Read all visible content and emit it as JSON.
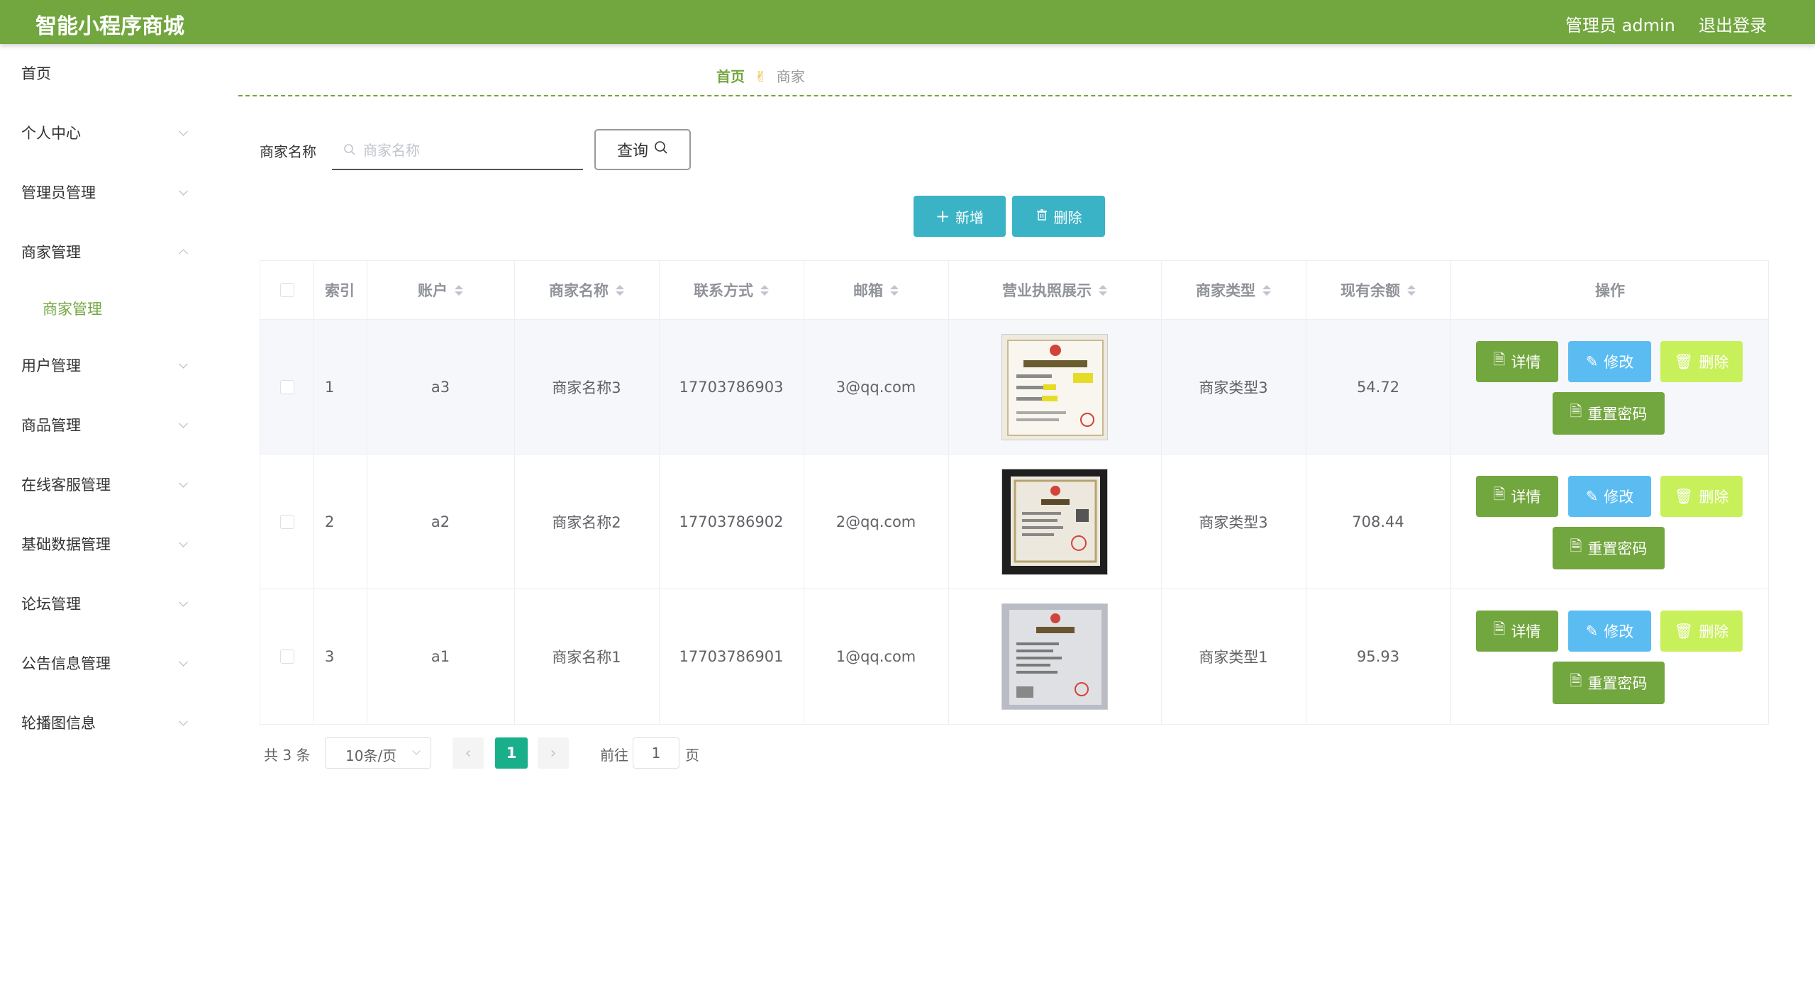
{
  "header": {
    "title": "智能小程序商城",
    "admin": "管理员 admin",
    "logout": "退出登录"
  },
  "sidebar": {
    "items": [
      {
        "label": "首页"
      },
      {
        "label": "个人中心"
      },
      {
        "label": "管理员管理"
      },
      {
        "label": "商家管理"
      },
      {
        "label": "商家管理"
      },
      {
        "label": "用户管理"
      },
      {
        "label": "商品管理"
      },
      {
        "label": "在线客服管理"
      },
      {
        "label": "基础数据管理"
      },
      {
        "label": "论坛管理"
      },
      {
        "label": "公告信息管理"
      },
      {
        "label": "轮播图信息"
      }
    ]
  },
  "breadcrumb": {
    "home": "首页",
    "separator": "✌",
    "current": "商家"
  },
  "search": {
    "label": "商家名称",
    "placeholder": "商家名称",
    "value": "",
    "button": "查询"
  },
  "toolbar": {
    "add": "新增",
    "delete": "删除"
  },
  "table": {
    "columns": [
      "索引",
      "账户",
      "商家名称",
      "联系方式",
      "邮箱",
      "营业执照展示",
      "商家类型",
      "现有余额",
      "操作"
    ],
    "rows": [
      {
        "index": "1",
        "account": "a3",
        "name": "商家名称3",
        "phone": "17703786903",
        "email": "3@qq.com",
        "type": "商家类型3",
        "balance": "54.72"
      },
      {
        "index": "2",
        "account": "a2",
        "name": "商家名称2",
        "phone": "17703786902",
        "email": "2@qq.com",
        "type": "商家类型3",
        "balance": "708.44"
      },
      {
        "index": "3",
        "account": "a1",
        "name": "商家名称1",
        "phone": "17703786901",
        "email": "1@qq.com",
        "type": "商家类型1",
        "balance": "95.93"
      }
    ],
    "actions": {
      "detail": "详情",
      "edit": "修改",
      "delete": "删除",
      "reset": "重置密码"
    }
  },
  "pagination": {
    "total": "共 3 条",
    "page_size": "10条/页",
    "current_page": "1",
    "goto": "前往",
    "goto_value": "1",
    "page_suffix": "页"
  },
  "colors": {
    "brand": "#72a63e",
    "teal": "#3ab3c6",
    "edit": "#5bbcf2",
    "delete": "#c8f05a",
    "page_active": "#1aaf8b"
  }
}
